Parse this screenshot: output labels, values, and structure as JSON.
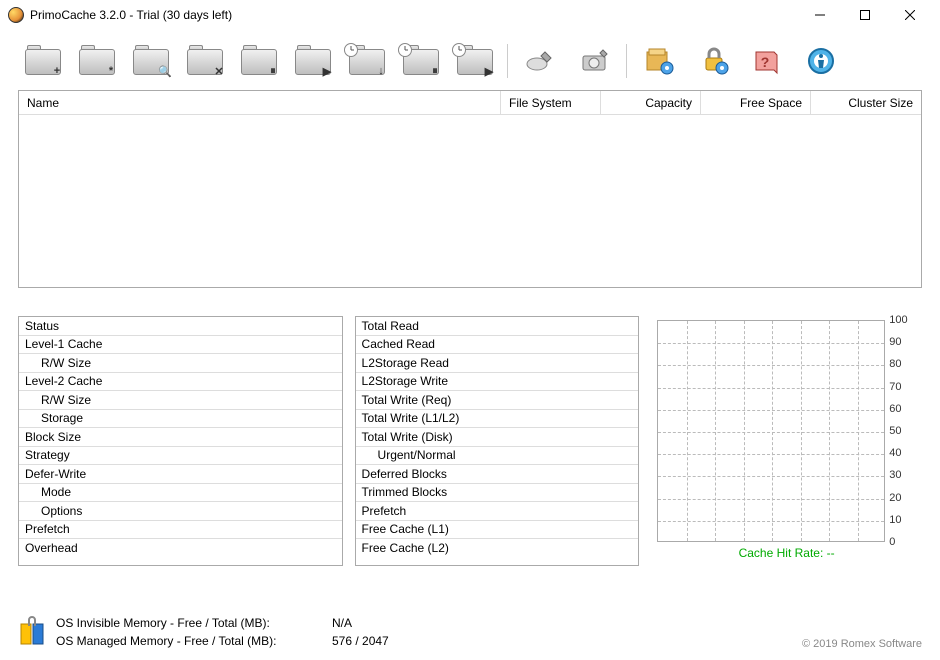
{
  "window": {
    "title": "PrimoCache 3.2.0 - Trial (30 days left)"
  },
  "toolbar": {
    "buttons": [
      {
        "name": "new-cache",
        "badge": "+"
      },
      {
        "name": "configure-cache",
        "badge": "*"
      },
      {
        "name": "view-cache",
        "badge": "🔍"
      },
      {
        "name": "delete-cache",
        "badge": "✕"
      },
      {
        "name": "pause-cache",
        "badge": "⏸"
      },
      {
        "name": "resume-cache",
        "badge": "▶"
      },
      {
        "name": "flush-defer",
        "badge": "↓",
        "clock": true
      },
      {
        "name": "pause-defer",
        "badge": "⏸",
        "clock": true
      },
      {
        "name": "resume-defer",
        "badge": "▶",
        "clock": true
      }
    ],
    "right_buttons": [
      {
        "name": "tools-button"
      },
      {
        "name": "storage-button"
      },
      {
        "name": "options-button"
      },
      {
        "name": "license-button"
      },
      {
        "name": "help-button"
      },
      {
        "name": "about-button"
      }
    ]
  },
  "table": {
    "columns": {
      "name": "Name",
      "fs": "File System",
      "capacity": "Capacity",
      "free": "Free Space",
      "cluster": "Cluster Size"
    }
  },
  "left_panel": [
    {
      "label": "Status"
    },
    {
      "label": "Level-1 Cache"
    },
    {
      "label": "R/W Size",
      "indent": true
    },
    {
      "label": "Level-2 Cache"
    },
    {
      "label": "R/W Size",
      "indent": true
    },
    {
      "label": "Storage",
      "indent": true
    },
    {
      "label": "Block Size"
    },
    {
      "label": "Strategy"
    },
    {
      "label": "Defer-Write"
    },
    {
      "label": "Mode",
      "indent": true
    },
    {
      "label": "Options",
      "indent": true
    },
    {
      "label": "Prefetch"
    },
    {
      "label": "Overhead"
    }
  ],
  "mid_panel": [
    {
      "label": "Total Read"
    },
    {
      "label": "Cached Read"
    },
    {
      "label": "L2Storage Read"
    },
    {
      "label": "L2Storage Write"
    },
    {
      "label": "Total Write (Req)"
    },
    {
      "label": "Total Write (L1/L2)"
    },
    {
      "label": "Total Write (Disk)"
    },
    {
      "label": "Urgent/Normal",
      "indent": true
    },
    {
      "label": "Deferred Blocks"
    },
    {
      "label": "Trimmed Blocks"
    },
    {
      "label": "Prefetch"
    },
    {
      "label": "Free Cache (L1)"
    },
    {
      "label": "Free Cache (L2)"
    }
  ],
  "chart_data": {
    "type": "line",
    "title": "",
    "xlabel": "",
    "ylabel": "",
    "ylim": [
      0,
      100
    ],
    "yticks": [
      0,
      10,
      20,
      30,
      40,
      50,
      60,
      70,
      80,
      90,
      100
    ],
    "series": [
      {
        "name": "Cache Hit Rate",
        "values": []
      }
    ],
    "footer_label": "Cache Hit Rate:",
    "footer_value": "--"
  },
  "status": {
    "invisible_label": "OS Invisible Memory - Free / Total (MB):",
    "invisible_value": "N/A",
    "managed_label": "OS Managed Memory - Free / Total (MB):",
    "managed_value": "576 / 2047"
  },
  "copyright": "© 2019 Romex Software"
}
